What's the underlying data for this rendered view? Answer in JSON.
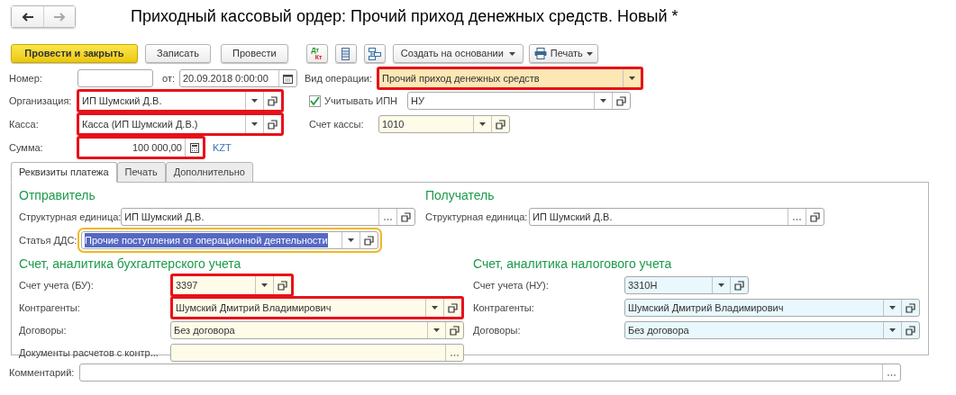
{
  "nav": [
    {
      "kind": "back",
      "disabled": false
    },
    {
      "kind": "forward",
      "disabled": true
    }
  ],
  "title": "Приходный кассовый ордер: Прочий приход денежных средств. Новый *",
  "toolbar": [
    {
      "kind": "primary",
      "label": "Провести и закрыть"
    },
    {
      "kind": "plain",
      "label": "Записать"
    },
    {
      "kind": "plain",
      "label": "Провести"
    },
    {
      "kind": "dtkt",
      "top": "Дт",
      "bottom": "Кт"
    },
    {
      "kind": "list"
    },
    {
      "kind": "structure"
    },
    {
      "kind": "menu",
      "label": "Создать на основании"
    },
    {
      "kind": "print",
      "label": "Печать"
    }
  ],
  "header": {
    "number": {
      "label": "Номер:",
      "color": "#ffffff"
    },
    "date": {
      "label": "от:",
      "value": "20.09.2018  0:00:00",
      "color": "#ffffff",
      "calendar": true
    },
    "operation": {
      "label": "Вид операции:",
      "value": "Прочий приход денежных средств",
      "color": "#fde7b5",
      "dropdown": true,
      "highlighted": true
    },
    "organization": {
      "label": "Организация:",
      "value": "ИП Шумский Д.В.",
      "color": "#ffffff",
      "dropdown": true,
      "open": true,
      "highlighted": true
    },
    "ipn": {
      "label": "Учитывать ИПН",
      "checked": true
    },
    "ipn_field": {
      "value": "НУ",
      "color": "#ffffff",
      "dropdown": true,
      "open": true
    },
    "cashbox": {
      "label": "Касса:",
      "value": "Касса (ИП Шумский Д.В.)",
      "color": "#ffffff",
      "dropdown": true,
      "open": true,
      "highlighted": true
    },
    "cash_account": {
      "label": "Счет кассы:",
      "value": "1010",
      "color": "#fefce8",
      "dropdown": true,
      "open": true
    },
    "amount": {
      "label": "Сумма:",
      "value": "100 000,00",
      "color": "#ffffff",
      "calculator": true,
      "right_aligned": true,
      "highlighted": true
    },
    "currency": "KZT"
  },
  "tabs": [
    {
      "label": "Реквизиты платежа",
      "selected": true
    },
    {
      "label": "Печать",
      "selected": false
    },
    {
      "label": "Дополнительно",
      "selected": false
    }
  ],
  "sender": {
    "heading": "Отправитель",
    "unit": {
      "label": "Структурная единица:",
      "value": "ИП Шумский Д.В.",
      "color": "#ffffff",
      "choose": true,
      "open": true
    },
    "cash_flow": {
      "label": "Статья ДДС:",
      "value": "Прочие поступления от операционной деятельности",
      "dropdown": true,
      "open": true,
      "focused": true,
      "text_selected": true
    }
  },
  "recipient": {
    "heading": "Получатель",
    "unit": {
      "label": "Структурная единица:",
      "value": "ИП Шумский Д.В.",
      "color": "#ffffff",
      "choose": true,
      "open": true
    }
  },
  "accounting": {
    "heading": "Счет, аналитика бухгалтерского учета",
    "rows": [
      {
        "label": "Счет учета (БУ):",
        "value": "3397",
        "color": "#fefce8",
        "dropdown": true,
        "open": true,
        "highlighted": true,
        "short": true
      },
      {
        "label": "Контрагенты:",
        "value": "Шумский Дмитрий Владимирович",
        "color": "#fefce8",
        "dropdown": true,
        "open": true,
        "highlighted": true,
        "short": false
      },
      {
        "label": "Договоры:",
        "value": "Без договора",
        "color": "#fefce8",
        "dropdown": true,
        "open": true,
        "highlighted": false,
        "short": false
      },
      {
        "label": "Документы расчетов с контр...",
        "color": "#fefce8",
        "choose": true,
        "highlighted": false,
        "short": false
      }
    ]
  },
  "tax": {
    "heading": "Счет, аналитика налогового учета",
    "rows": [
      {
        "label": "Счет учета (НУ):",
        "value": "3310Н",
        "color": "#e8f8fd",
        "dropdown": true,
        "open": true,
        "highlighted": false,
        "short": true
      },
      {
        "label": "Контрагенты:",
        "value": "Шумский Дмитрий Владимирович",
        "color": "#e8f8fd",
        "dropdown": true,
        "open": true,
        "highlighted": false,
        "short": false
      },
      {
        "label": "Договоры:",
        "value": "Без договора",
        "color": "#e8f8fd",
        "dropdown": true,
        "open": true,
        "highlighted": false,
        "short": false
      }
    ]
  },
  "comment": {
    "label": "Комментарий:",
    "color": "#ffffff",
    "choose": true
  }
}
